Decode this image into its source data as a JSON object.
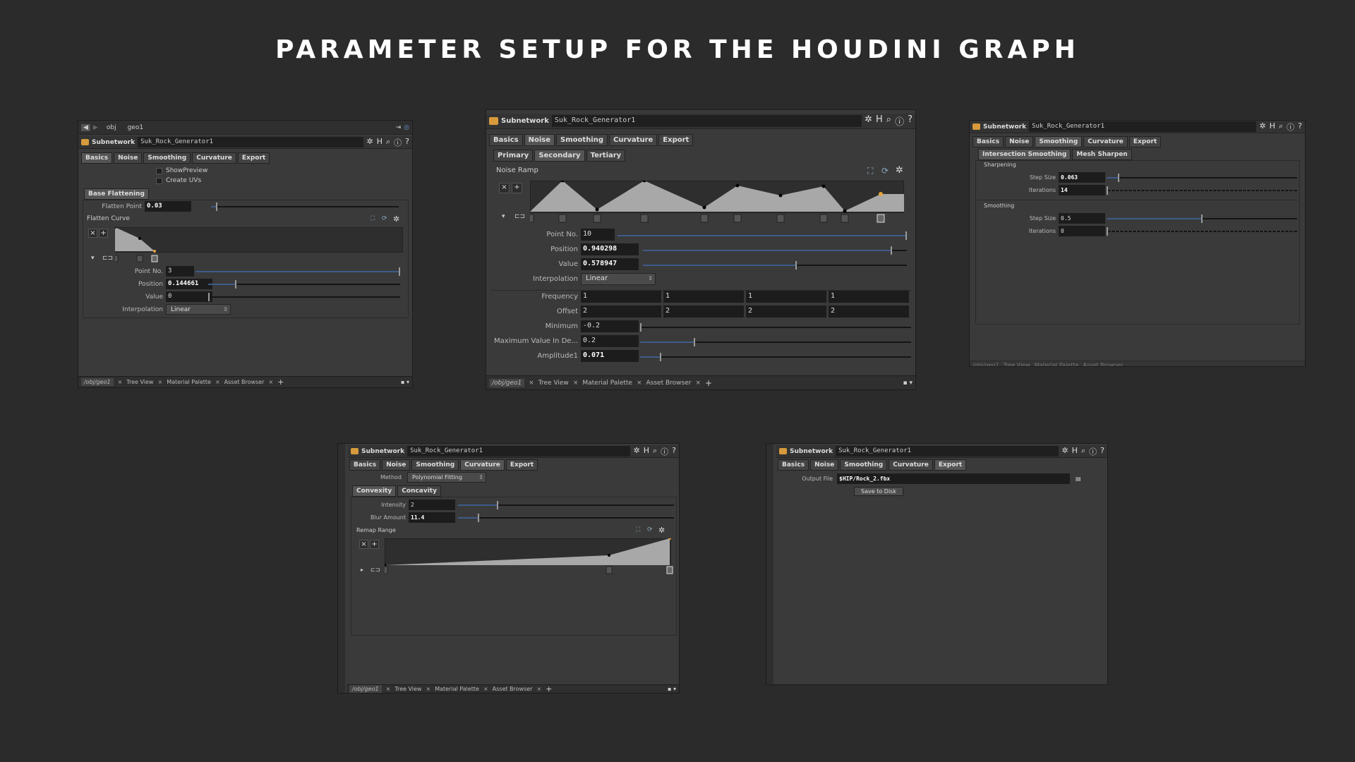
{
  "page_title": "PARAMETER SETUP FOR THE HOUDINI GRAPH",
  "node": {
    "type": "Subnetwork",
    "name": "Suk_Rock_Generator1"
  },
  "tabs": [
    "Basics",
    "Noise",
    "Smoothing",
    "Curvature",
    "Export"
  ],
  "p1": {
    "path_obj": "obj",
    "path_geo": "geo1",
    "show_preview": "ShowPreview",
    "create_uvs": "Create UVs",
    "section": "Base Flattening",
    "flatten_point_label": "Flatten Point",
    "flatten_point": "0.03",
    "flatten_point_frac": 0.03,
    "curve_label": "Flatten Curve",
    "point_no_label": "Point No.",
    "point_no": "3",
    "position_label": "Position",
    "position": "0.144661",
    "position_frac": 0.144661,
    "value_label": "Value",
    "value": "0",
    "value_frac": 0,
    "interp_label": "Interpolation",
    "interp": "Linear"
  },
  "p2": {
    "subtabs": [
      "Primary",
      "Secondary",
      "Tertiary"
    ],
    "ramp_label": "Noise Ramp",
    "point_no_label": "Point No.",
    "point_no": "10",
    "position_label": "Position",
    "position": "0.940298",
    "position_frac": 0.940298,
    "value_label": "Value",
    "value": "0.578947",
    "value_frac": 0.578947,
    "interp_label": "Interpolation",
    "interp": "Linear",
    "freq_label": "Frequency",
    "freq": [
      "1",
      "1",
      "1",
      "1"
    ],
    "offset_label": "Offset",
    "offset": [
      "2",
      "2",
      "2",
      "2"
    ],
    "min_label": "Minimum",
    "min": "-0.2",
    "max_label": "Maximum Value In De...",
    "max": "0.2",
    "amp_label": "Amplitude1",
    "amp": "0.071"
  },
  "p3": {
    "subtabs": [
      "Intersection Smoothing",
      "Mesh Sharpen"
    ],
    "sharpening": "Sharpening",
    "sh_step_label": "Step Size",
    "sh_step": "0.063",
    "sh_step_frac": 0.063,
    "sh_iter_label": "Iterations",
    "sh_iter": "14",
    "smoothing": "Smoothing",
    "sm_step_label": "Step Size",
    "sm_step": "0.5",
    "sm_step_frac": 0.5,
    "sm_iter_label": "Iterations",
    "sm_iter": "0"
  },
  "p4": {
    "method_label": "Method",
    "method": "Polynomial Fitting",
    "subtabs": [
      "Convexity",
      "Concavity"
    ],
    "intensity_label": "Intensity",
    "intensity": "2",
    "blur_label": "Blur Amount",
    "blur": "11.4",
    "ramp_label": "Remap Range"
  },
  "p5": {
    "output_label": "Output File",
    "output": "$HIP/Rock_2.fbx",
    "save_btn": "Save to Disk"
  },
  "footer": {
    "path": "/obj/geo1",
    "tabs": [
      "Tree View",
      "Material Palette",
      "Asset Browser"
    ]
  },
  "icons": [
    "gear-icon",
    "help-icon",
    "info-icon",
    "search-icon",
    "folder-icon"
  ]
}
